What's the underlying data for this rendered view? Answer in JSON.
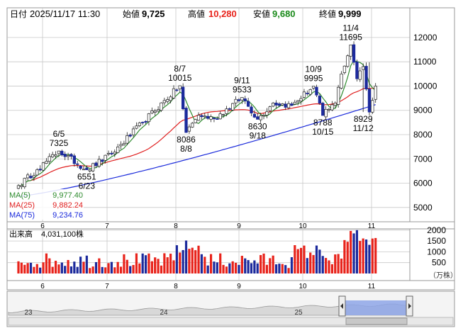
{
  "header": {
    "date_label": "日付",
    "date_value": "2025/11/17 11:30",
    "open_label": "始値",
    "open_value": "9,725",
    "high_label": "高値",
    "high_value": "10,280",
    "low_label": "安値",
    "low_value": "9,680",
    "close_label": "終値",
    "close_value": "9,999"
  },
  "legend": {
    "ma5_label": "MA(5)",
    "ma5_value": "9,977.40",
    "ma25_label": "MA(25)",
    "ma25_value": "9,882.24",
    "ma75_label": "MA(75)",
    "ma75_value": "9,234.76"
  },
  "volume_header": {
    "label": "出来高",
    "value": "4,031,100株"
  },
  "volume_unit": "（万株）",
  "colors": {
    "up": "#e8231b",
    "down": "#1c2a9c",
    "ma5": "#2e8b2e",
    "ma25": "#e02020",
    "ma75": "#1a2adb",
    "grid": "#c8c8c8",
    "nav_fill": "#8ea6e8"
  },
  "chart_data": [
    {
      "type": "candlestick",
      "ylim": [
        4500,
        12800
      ],
      "y_ticks": [
        "12000",
        "11000",
        "10000",
        "9000",
        "8000",
        "7000",
        "6000",
        "5000"
      ],
      "x_ticks": [
        "6",
        "7",
        "8",
        "9",
        "10",
        "11"
      ],
      "annotations": [
        {
          "top": "6/5",
          "bottom": "7325",
          "value": 7325
        },
        {
          "top": "6551",
          "bottom": "6/23",
          "value": 6551
        },
        {
          "top": "8/7",
          "bottom": "10015",
          "value": 10015
        },
        {
          "top": "8086",
          "bottom": "8/8",
          "value": 8086
        },
        {
          "top": "9/11",
          "bottom": "9533",
          "value": 9533
        },
        {
          "top": "8630",
          "bottom": "9/18",
          "value": 8630
        },
        {
          "top": "10/9",
          "bottom": "9995",
          "value": 9995
        },
        {
          "top": "8788",
          "bottom": "10/15",
          "value": 8788
        },
        {
          "top": "11/4",
          "bottom": "11695",
          "value": 11695
        },
        {
          "top": "8929",
          "bottom": "11/12",
          "value": 8929
        }
      ],
      "key_prices": [
        5900,
        6550,
        7325,
        6551,
        7200,
        8500,
        10015,
        8086,
        8800,
        8650,
        9533,
        8630,
        9300,
        9200,
        9995,
        8788,
        9300,
        10500,
        11695,
        10300,
        10800,
        8929,
        9999
      ],
      "ma75_end": 9234.76,
      "ma25_end": 9882.24,
      "ma5_end": 9977.4
    },
    {
      "type": "bar",
      "name": "出来高",
      "ylim": [
        0,
        2200
      ],
      "y_ticks": [
        "2000",
        "1500",
        "1000",
        "500"
      ],
      "x_ticks": [
        "6",
        "7",
        "8",
        "9",
        "10",
        "11"
      ]
    },
    {
      "type": "area",
      "x_ticks": [
        "23",
        "24",
        "25"
      ]
    }
  ]
}
